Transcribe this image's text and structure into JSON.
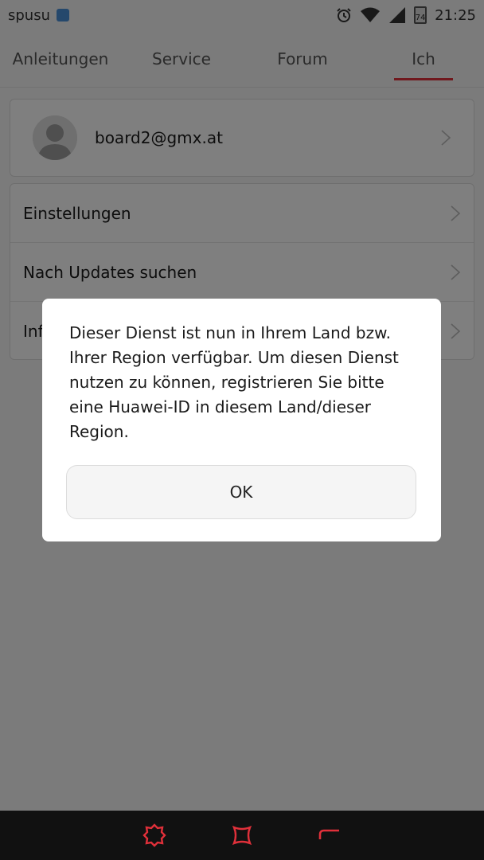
{
  "status_bar": {
    "carrier": "spusu",
    "battery": "74",
    "time": "21:25"
  },
  "tabs": [
    {
      "label": "Anleitungen",
      "active": false
    },
    {
      "label": "Service",
      "active": false
    },
    {
      "label": "Forum",
      "active": false
    },
    {
      "label": "Ich",
      "active": true
    }
  ],
  "profile": {
    "email": "board2@gmx.at"
  },
  "menu": {
    "items": [
      {
        "label": "Einstellungen"
      },
      {
        "label": "Nach Updates suchen"
      },
      {
        "label": "Inf"
      }
    ]
  },
  "dialog": {
    "message": "Dieser Dienst ist nun in Ihrem Land bzw. Ihrer Region verfügbar. Um diesen Dienst nutzen zu können, registrieren Sie bitte eine Huawei-ID in diesem Land/dieser Region.",
    "ok_label": "OK"
  },
  "colors": {
    "accent": "#e0303a",
    "nav_bar": "#111111",
    "nav_icon": "#e0303a"
  },
  "icons": {
    "carrier_badge": "app-notification-icon",
    "alarm": "alarm-icon",
    "wifi": "wifi-icon",
    "signal": "signal-icon",
    "battery": "battery-icon",
    "avatar": "user-avatar-icon",
    "chevron": "chevron-right-icon",
    "nav_back": "back-icon",
    "nav_home": "home-icon",
    "nav_recent": "recent-apps-icon"
  }
}
